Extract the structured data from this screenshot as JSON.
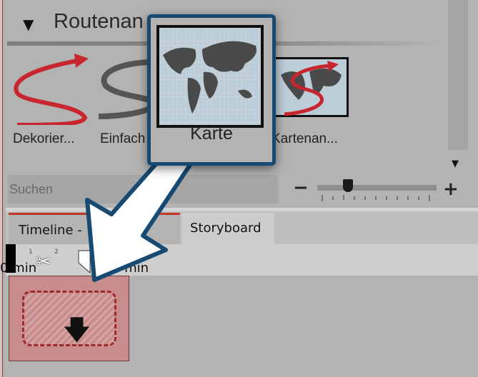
{
  "panel": {
    "title": "Routenan",
    "collapse_icon": "triangle-down-icon"
  },
  "templates": [
    {
      "label": "Dekorier..."
    },
    {
      "label": "Einfach"
    },
    {
      "label": "Kartenan..."
    }
  ],
  "popup": {
    "label": "Karte"
  },
  "search": {
    "placeholder": "Suchen"
  },
  "zoom_slider": {
    "minus": "−",
    "plus": "+",
    "value_percent": 25
  },
  "tabs": [
    {
      "label": "Timeline - Standardansicht"
    },
    {
      "label": "Storyboard"
    }
  ],
  "ruler": {
    "start": "0 min",
    "second": "0:05 min",
    "tick1": "1",
    "tick2": "2"
  },
  "colors": {
    "accent_red": "#c0392b",
    "arrow_border": "#174a72",
    "clip": "#c98c8c"
  }
}
